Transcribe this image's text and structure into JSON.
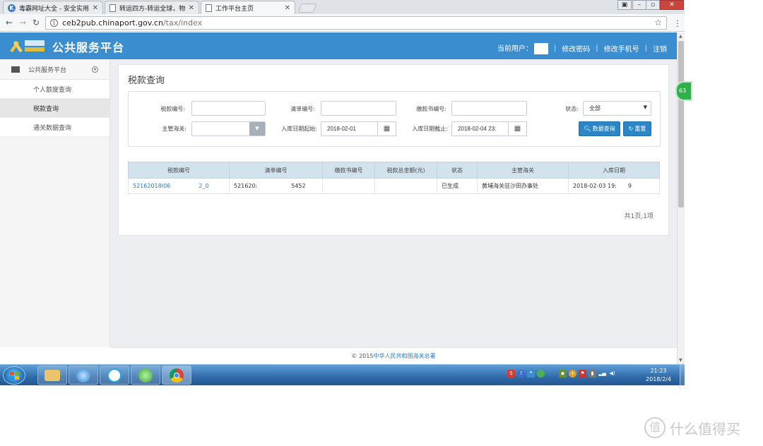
{
  "browser": {
    "tabs": [
      {
        "title": "毒霸网址大全 - 安全实用",
        "active": false
      },
      {
        "title": "转运四方-转运全球，物流",
        "active": false
      },
      {
        "title": "工作平台主页",
        "active": true
      }
    ],
    "url_host": "ceb2pub.chinaport.gov.cn",
    "url_path": "/tax/index"
  },
  "header": {
    "site_title": "公共服务平台",
    "current_user_label": "当前用户：",
    "change_password": "修改密码",
    "change_phone": "修改手机号",
    "logout": "注销"
  },
  "sidebar": {
    "section": "公共服务平台",
    "items": [
      {
        "label": "个人额度查询",
        "active": false
      },
      {
        "label": "税款查询",
        "active": true
      },
      {
        "label": "通关数据查询",
        "active": false
      }
    ]
  },
  "float_badge": "63",
  "main": {
    "title": "税款查询",
    "form": {
      "tax_no_label": "税款编号:",
      "list_no_label": "清单编号:",
      "payment_no_label": "缴款书编号:",
      "status_label": "状态:",
      "status_value": "全部",
      "customs_label": "主管海关:",
      "date_from_label": "入库日期起始:",
      "date_from_value": "2018-02-01",
      "date_to_label": "入库日期截止:",
      "date_to_value": "2018-02-04 23:",
      "search_button": "数据查询",
      "reset_button": "重置"
    },
    "table": {
      "columns": [
        "税款编号",
        "清单编号",
        "缴款书编号",
        "税款总金额(元)",
        "状态",
        "主管海关",
        "入库日期"
      ],
      "rows": [
        {
          "tax_no": "52162018I06　　　　　2_0",
          "list_no": "521620:　　　　　　5452",
          "payment_no": "",
          "total_amount": "",
          "status": "已生成",
          "customs": "黄埔海关驻沙田办事处",
          "date": "2018-02-03 19:　　9"
        }
      ]
    },
    "pagination": "共1页,1项"
  },
  "footer": {
    "copyright": "© 2015",
    "org": "中华人民共和国海关总署"
  },
  "taskbar": {
    "time": "21:23",
    "date": "2018/2/4"
  },
  "watermark": {
    "glyph": "值",
    "text": "什么值得买"
  }
}
